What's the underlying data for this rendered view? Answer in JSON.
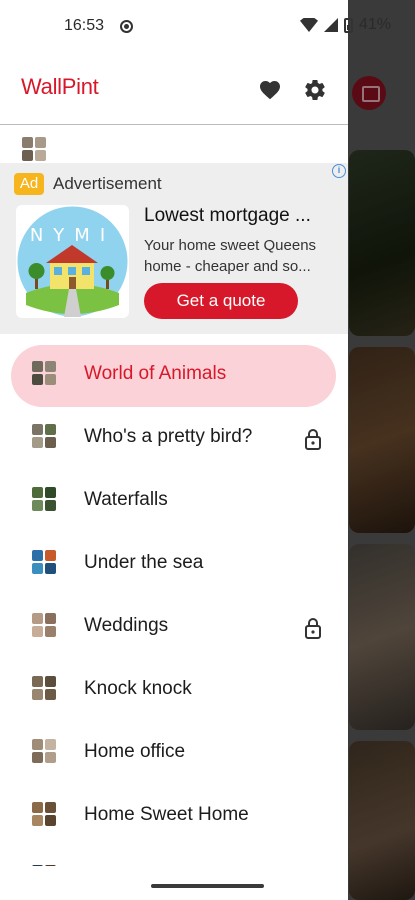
{
  "status_bar": {
    "time": "16:53",
    "battery": "41%"
  },
  "drawer": {
    "app_title": "WallPint",
    "icons": [
      "heart-icon",
      "gear-icon"
    ]
  },
  "ad": {
    "badge": "Ad",
    "label": "Advertisement",
    "image_text": "NYMI",
    "title": "Lowest mortgage ...",
    "description_line1": "Your home sweet Queens",
    "description_line2": "home - cheaper and so...",
    "cta": "Get a quote"
  },
  "menu": {
    "items": [
      {
        "label": "World of Animals",
        "active": true,
        "locked": false
      },
      {
        "label": "Who's a pretty bird?",
        "active": false,
        "locked": true
      },
      {
        "label": "Waterfalls",
        "active": false,
        "locked": false
      },
      {
        "label": "Under the sea",
        "active": false,
        "locked": false
      },
      {
        "label": "Weddings",
        "active": false,
        "locked": true
      },
      {
        "label": "Knock knock",
        "active": false,
        "locked": false
      },
      {
        "label": "Home office",
        "active": false,
        "locked": false
      },
      {
        "label": "Home Sweet Home",
        "active": false,
        "locked": false
      }
    ]
  },
  "colors": {
    "brand": "#d7182a",
    "active_bg": "#fad2d7",
    "ad_badge": "#f6b51d"
  }
}
